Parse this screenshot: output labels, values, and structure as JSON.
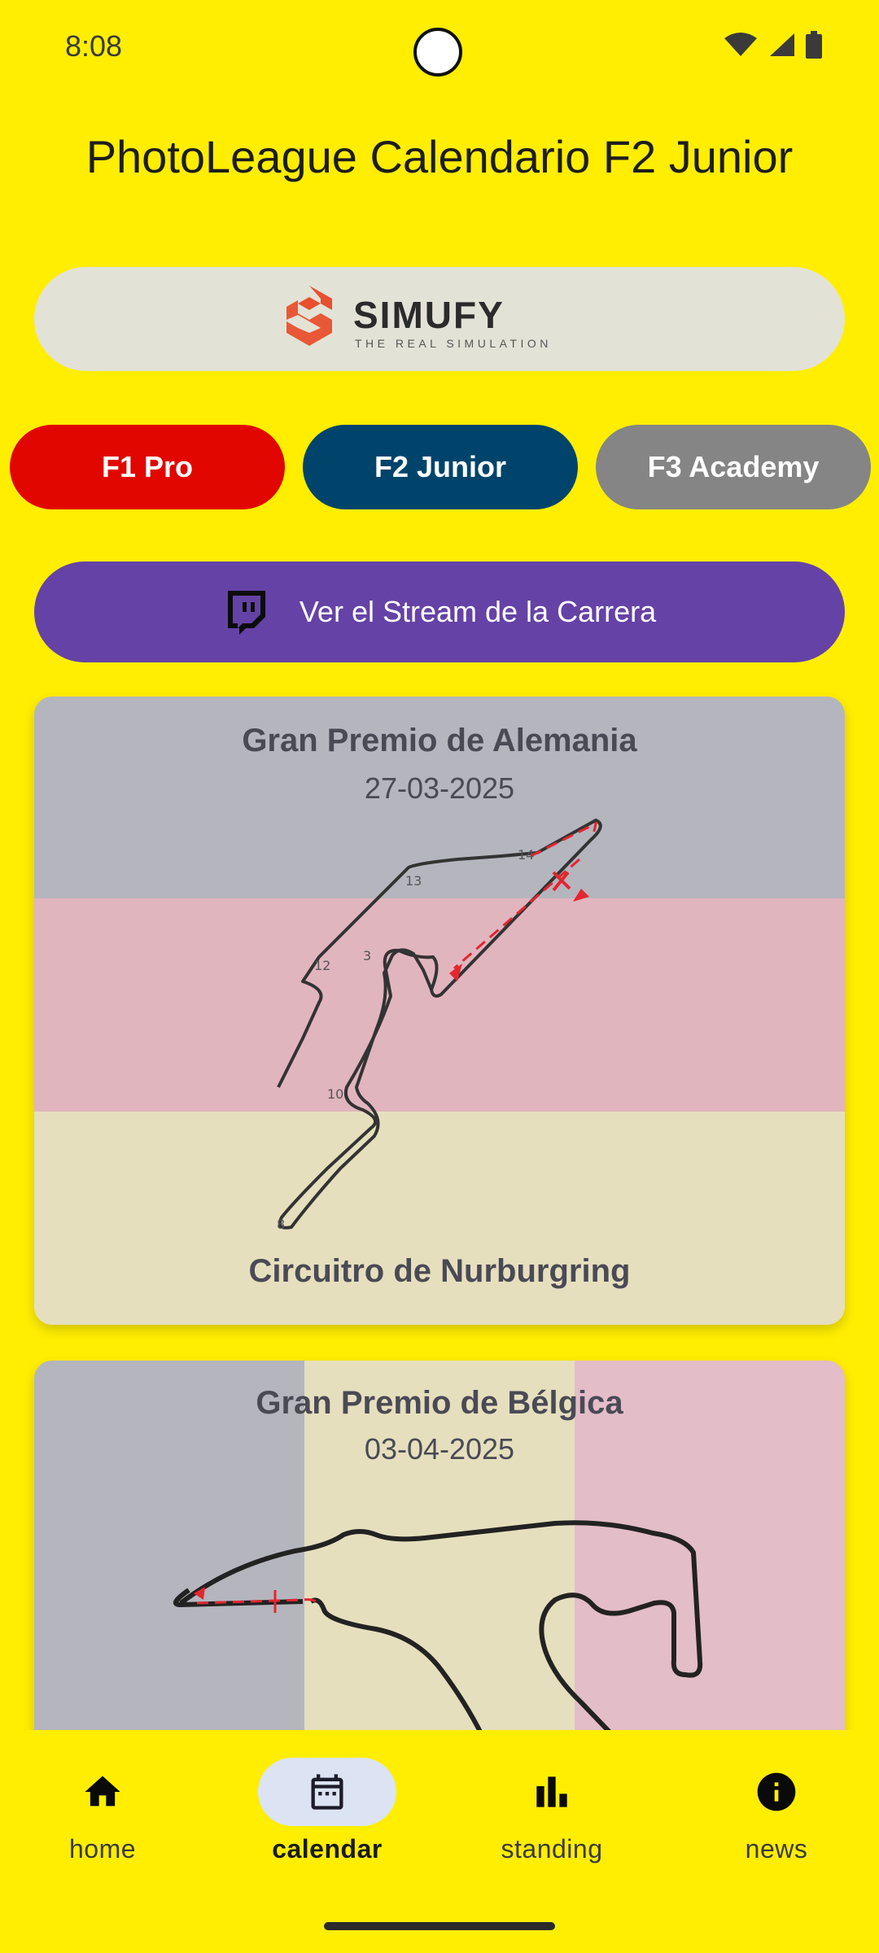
{
  "status": {
    "time": "8:08"
  },
  "page": {
    "title": "PhotoLeague Calendario F2 Junior"
  },
  "sponsor": {
    "brand": "SIMUFY",
    "tagline": "THE REAL SIMULATION"
  },
  "categories": [
    {
      "label": "F1 Pro",
      "color": "#E10600"
    },
    {
      "label": "F2 Junior",
      "color": "#00446B"
    },
    {
      "label": "F3 Academy",
      "color": "#858585"
    }
  ],
  "stream_button": {
    "label": "Ver el Stream de la Carrera",
    "icon": "twitch-icon",
    "color": "#6542A6"
  },
  "races": [
    {
      "title": "Gran Premio de Alemania",
      "date": "27-03-2025",
      "circuit": "Circuitro de Nurburgring",
      "flag_colors": [
        "#B5B5BE",
        "#E1B5BE",
        "#E6DFBE"
      ],
      "turn_labels": [
        "14",
        "13",
        "12",
        "3",
        "10",
        "8"
      ]
    },
    {
      "title": "Gran Premio de Bélgica",
      "date": "03-04-2025",
      "flag_colors": [
        "#B5B5BE",
        "#E6DFBE",
        "#E3BDC8"
      ]
    }
  ],
  "nav": [
    {
      "label": "home",
      "icon": "home-icon",
      "active": false
    },
    {
      "label": "calendar",
      "icon": "calendar-icon",
      "active": true
    },
    {
      "label": "standing",
      "icon": "bar-chart-icon",
      "active": false
    },
    {
      "label": "news",
      "icon": "info-icon",
      "active": false
    }
  ]
}
